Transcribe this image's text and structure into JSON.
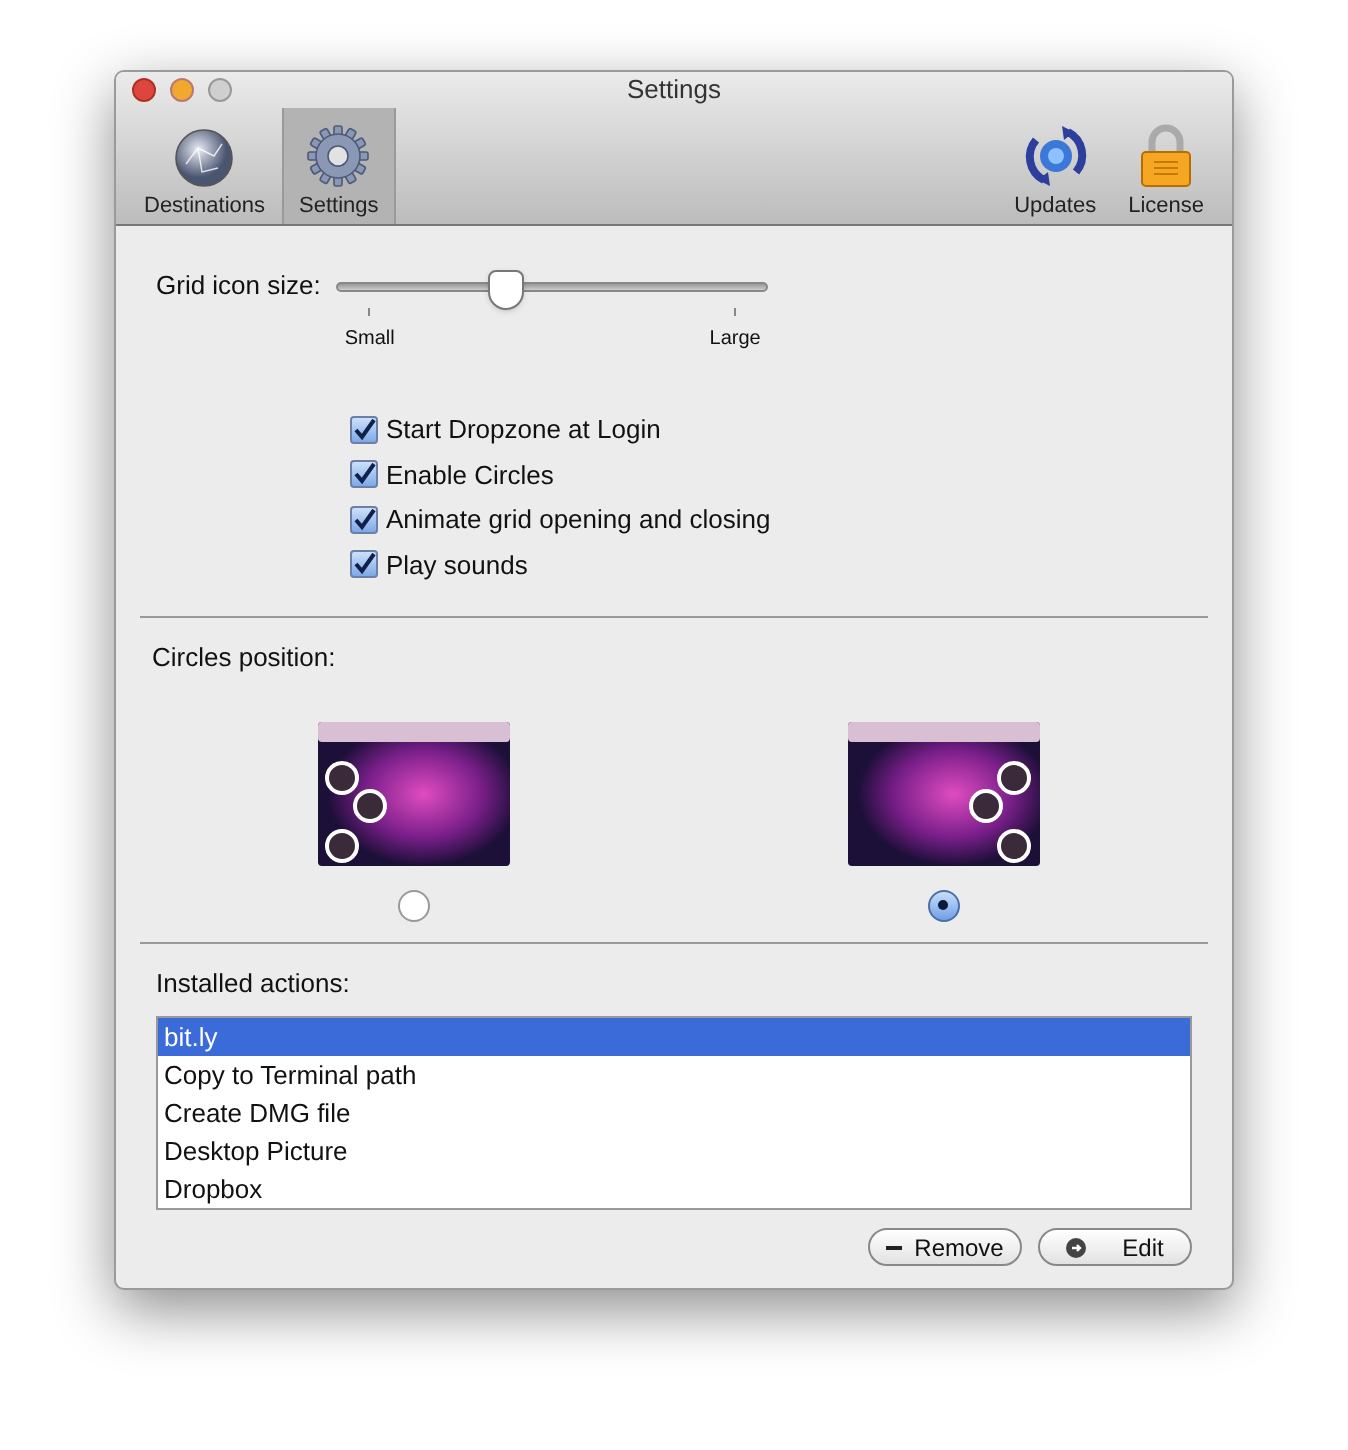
{
  "window": {
    "title": "Settings"
  },
  "toolbar": [
    {
      "label": "Destinations",
      "kind": "globe",
      "selected": false
    },
    {
      "label": "Settings",
      "kind": "gear",
      "selected": true
    },
    {
      "label": "Updates",
      "kind": "sync",
      "selected": false
    },
    {
      "label": "License",
      "kind": "lock",
      "selected": false
    }
  ],
  "grid_icon_size": {
    "label": "Grid icon size:",
    "level": 0.39,
    "min_label": "Small",
    "max_label": "Large"
  },
  "options": [
    {
      "label": "Start Dropzone at Login",
      "checked": true
    },
    {
      "label": "Enable Circles",
      "checked": true
    },
    {
      "label": "Animate grid opening and closing",
      "checked": true
    },
    {
      "label": "Play sounds",
      "checked": true
    }
  ],
  "circles_position": {
    "label": "Circles position:",
    "choices": [
      {
        "kind": "left",
        "selected": false
      },
      {
        "kind": "right",
        "selected": true
      }
    ]
  },
  "installed_actions": {
    "label": "Installed actions:",
    "items": [
      {
        "label": "bit.ly",
        "selected": true
      },
      {
        "label": "Copy to Terminal path",
        "selected": false
      },
      {
        "label": "Create DMG file",
        "selected": false
      },
      {
        "label": "Desktop Picture",
        "selected": false
      },
      {
        "label": "Dropbox",
        "selected": false
      }
    ]
  },
  "buttons": [
    {
      "label": "Remove",
      "kind": "remove"
    },
    {
      "label": "Edit",
      "kind": "edit"
    }
  ]
}
